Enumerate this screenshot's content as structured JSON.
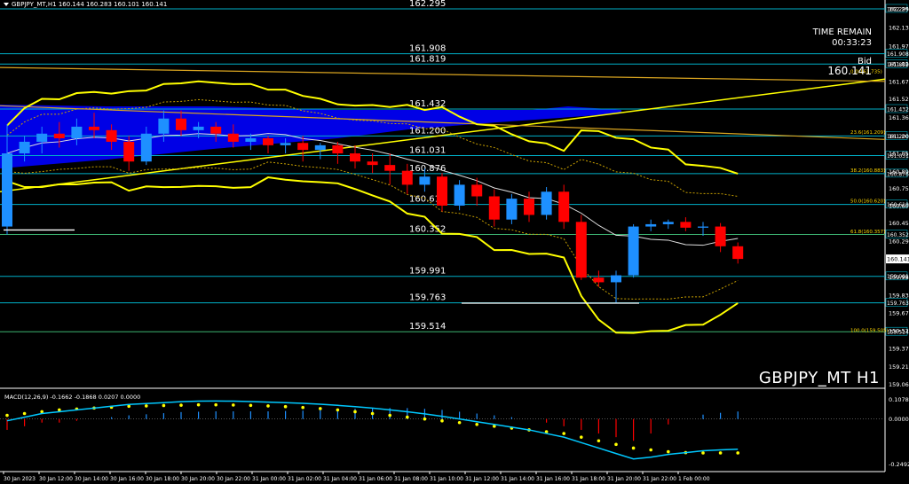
{
  "header": {
    "symbol_timeframe": "GBPJPY_MT,H1",
    "ohlc": "160.144 160.283 160.101 160.141",
    "text": "GBPJPY_MT,H1  160.144 160.283 160.101 160.141"
  },
  "info_panel": {
    "time_remain_label": "TIME REMAIN",
    "time_remain_value": "00:33:23",
    "bid_label": "Bid",
    "bid_value": "160.141"
  },
  "symbol_watermark": "GBPJPY_MT H1",
  "macd_label": "MACD(12,26,9) -0.1662 -0.1868 0.0207 0.0000",
  "colors": {
    "background": "#000000",
    "bull_candle": "#1e90ff",
    "bear_candle": "#ff0000",
    "band": "#ffff00",
    "cloud": "#0000ff",
    "level_line": "#00b0c8",
    "level_line_green": "#3cb371",
    "macd_line": "#00c8ff",
    "macd_signal": "#ffff00",
    "macd_hist_neg": "#ff0000",
    "macd_hist_pos": "#1e90ff"
  },
  "chart_data": {
    "type": "candlestick",
    "symbol": "GBPJPY_MT",
    "timeframe": "H1",
    "price_axis": {
      "ticks": [
        162.295,
        162.135,
        161.975,
        161.82,
        161.67,
        161.52,
        161.36,
        161.2,
        161.05,
        160.895,
        160.75,
        160.6,
        160.45,
        160.295,
        160.141,
        159.985,
        159.83,
        159.675,
        159.525,
        159.37,
        159.215,
        159.06
      ],
      "ticks_text": [
        "162.295",
        "162.135",
        "161.975",
        "161.820",
        "161.670",
        "161.520",
        "161.360",
        "161.200",
        "161.050",
        "160.895",
        "160.750",
        "160.600",
        "160.450",
        "160.295",
        "160.141",
        "159.985",
        "159.830",
        "159.675",
        "159.525",
        "159.370",
        "159.215",
        "159.060"
      ],
      "range": [
        159.05,
        162.31
      ]
    },
    "levels": [
      {
        "label": "162.295",
        "value": 162.295
      },
      {
        "label": "161.908",
        "value": 161.908
      },
      {
        "label": "161.819",
        "value": 161.819
      },
      {
        "label": "161.432",
        "value": 161.432
      },
      {
        "label": "161.200",
        "value": 161.2
      },
      {
        "label": "161.031",
        "value": 161.031
      },
      {
        "label": "160.876",
        "value": 160.876
      },
      {
        "label": "160.610",
        "value": 160.61
      },
      {
        "label": "160.352",
        "value": 160.352
      },
      {
        "label": "159.991",
        "value": 159.991
      },
      {
        "label": "159.763",
        "value": 159.763
      },
      {
        "label": "159.514",
        "value": 159.514
      }
    ],
    "fibo": [
      {
        "label": "0.0(161.735)",
        "value": 161.735
      },
      {
        "label": "23.6(161.209)",
        "value": 161.209
      },
      {
        "label": "38.2(160.883)",
        "value": 160.883
      },
      {
        "label": "50.0(160.620)",
        "value": 160.62
      },
      {
        "label": "61.8(160.357)",
        "value": 160.357
      },
      {
        "label": "100.0(159.505)",
        "value": 159.505
      }
    ],
    "x_labels": [
      "30 Jan 2023",
      "30 Jan 12:00",
      "30 Jan 14:00",
      "30 Jan 16:00",
      "30 Jan 18:00",
      "30 Jan 20:00",
      "30 Jan 22:00",
      "31 Jan 00:00",
      "31 Jan 02:00",
      "31 Jan 04:00",
      "31 Jan 06:00",
      "31 Jan 08:00",
      "31 Jan 10:00",
      "31 Jan 12:00",
      "31 Jan 14:00",
      "31 Jan 16:00",
      "31 Jan 18:00",
      "31 Jan 20:00",
      "31 Jan 22:00",
      "1 Feb 00:00"
    ],
    "candles": [
      {
        "o": 160.42,
        "h": 161.3,
        "c": 161.05,
        "l": 160.35
      },
      {
        "o": 161.05,
        "h": 161.2,
        "c": 161.15,
        "l": 160.98
      },
      {
        "o": 161.15,
        "h": 161.28,
        "c": 161.22,
        "l": 161.05
      },
      {
        "o": 161.22,
        "h": 161.32,
        "c": 161.18,
        "l": 161.1
      },
      {
        "o": 161.18,
        "h": 161.35,
        "c": 161.28,
        "l": 161.12
      },
      {
        "o": 161.28,
        "h": 161.4,
        "c": 161.25,
        "l": 161.18
      },
      {
        "o": 161.25,
        "h": 161.3,
        "c": 161.15,
        "l": 161.08
      },
      {
        "o": 161.15,
        "h": 161.2,
        "c": 160.98,
        "l": 160.9
      },
      {
        "o": 160.98,
        "h": 161.28,
        "c": 161.22,
        "l": 160.95
      },
      {
        "o": 161.22,
        "h": 161.42,
        "c": 161.35,
        "l": 161.15
      },
      {
        "o": 161.35,
        "h": 161.42,
        "c": 161.25,
        "l": 161.2
      },
      {
        "o": 161.25,
        "h": 161.32,
        "c": 161.28,
        "l": 161.18
      },
      {
        "o": 161.28,
        "h": 161.32,
        "c": 161.22,
        "l": 161.15
      },
      {
        "o": 161.22,
        "h": 161.3,
        "c": 161.15,
        "l": 161.1
      },
      {
        "o": 161.15,
        "h": 161.22,
        "c": 161.18,
        "l": 161.08
      },
      {
        "o": 161.18,
        "h": 161.2,
        "c": 161.12,
        "l": 161.05
      },
      {
        "o": 161.12,
        "h": 161.18,
        "c": 161.14,
        "l": 161.05
      },
      {
        "o": 161.14,
        "h": 161.2,
        "c": 161.08,
        "l": 160.98
      },
      {
        "o": 161.08,
        "h": 161.14,
        "c": 161.12,
        "l": 161.0
      },
      {
        "o": 161.12,
        "h": 161.15,
        "c": 161.05,
        "l": 160.96
      },
      {
        "o": 161.05,
        "h": 161.12,
        "c": 160.98,
        "l": 160.92
      },
      {
        "o": 160.98,
        "h": 161.05,
        "c": 160.95,
        "l": 160.88
      },
      {
        "o": 160.95,
        "h": 161.05,
        "c": 160.9,
        "l": 160.78
      },
      {
        "o": 160.9,
        "h": 160.96,
        "c": 160.78,
        "l": 160.7
      },
      {
        "o": 160.78,
        "h": 160.92,
        "c": 160.85,
        "l": 160.72
      },
      {
        "o": 160.85,
        "h": 160.88,
        "c": 160.6,
        "l": 160.55
      },
      {
        "o": 160.6,
        "h": 160.82,
        "c": 160.78,
        "l": 160.56
      },
      {
        "o": 160.78,
        "h": 160.84,
        "c": 160.68,
        "l": 160.6
      },
      {
        "o": 160.68,
        "h": 160.74,
        "c": 160.48,
        "l": 160.42
      },
      {
        "o": 160.48,
        "h": 160.7,
        "c": 160.66,
        "l": 160.44
      },
      {
        "o": 160.66,
        "h": 160.72,
        "c": 160.52,
        "l": 160.46
      },
      {
        "o": 160.52,
        "h": 160.76,
        "c": 160.72,
        "l": 160.48
      },
      {
        "o": 160.72,
        "h": 160.78,
        "c": 160.46,
        "l": 160.4
      },
      {
        "o": 160.46,
        "h": 160.52,
        "c": 159.98,
        "l": 159.96
      },
      {
        "o": 159.98,
        "h": 160.04,
        "c": 159.94,
        "l": 159.9
      },
      {
        "o": 159.94,
        "h": 160.04,
        "c": 160.0,
        "l": 159.76
      },
      {
        "o": 160.0,
        "h": 160.44,
        "c": 160.42,
        "l": 159.98
      },
      {
        "o": 160.42,
        "h": 160.48,
        "c": 160.44,
        "l": 160.38
      },
      {
        "o": 160.44,
        "h": 160.48,
        "c": 160.46,
        "l": 160.4
      },
      {
        "o": 160.46,
        "h": 160.5,
        "c": 160.41,
        "l": 160.38
      },
      {
        "o": 160.41,
        "h": 160.46,
        "c": 160.42,
        "l": 160.34
      },
      {
        "o": 160.42,
        "h": 160.45,
        "c": 160.25,
        "l": 160.2
      },
      {
        "o": 160.25,
        "h": 160.283,
        "c": 160.141,
        "l": 160.101
      }
    ],
    "macd": {
      "label": "MACD(12,26,9) -0.1662 -0.1868 0.0207 0.0000",
      "ticks": [
        0.1078,
        0.0,
        -0.2492
      ],
      "ticks_text": [
        "0.1078",
        "0.0000",
        "-0.2492"
      ],
      "range": [
        -0.27,
        0.13
      ],
      "main": [
        -0.01,
        0.01,
        0.03,
        0.04,
        0.05,
        0.06,
        0.07,
        0.08,
        0.085,
        0.09,
        0.095,
        0.098,
        0.099,
        0.098,
        0.096,
        0.093,
        0.09,
        0.086,
        0.081,
        0.075,
        0.068,
        0.06,
        0.05,
        0.04,
        0.028,
        0.015,
        0.0,
        -0.015,
        -0.03,
        -0.045,
        -0.06,
        -0.08,
        -0.1,
        -0.13,
        -0.16,
        -0.19,
        -0.22,
        -0.21,
        -0.195,
        -0.185,
        -0.175,
        -0.17,
        -0.1662
      ],
      "signal": [
        0.02,
        0.03,
        0.04,
        0.05,
        0.055,
        0.06,
        0.065,
        0.07,
        0.072,
        0.074,
        0.076,
        0.078,
        0.078,
        0.077,
        0.075,
        0.072,
        0.068,
        0.063,
        0.057,
        0.05,
        0.04,
        0.03,
        0.02,
        0.01,
        0.0,
        -0.01,
        -0.02,
        -0.03,
        -0.04,
        -0.05,
        -0.06,
        -0.07,
        -0.08,
        -0.1,
        -0.12,
        -0.14,
        -0.16,
        -0.17,
        -0.18,
        -0.185,
        -0.187,
        -0.187,
        -0.1868
      ]
    }
  }
}
